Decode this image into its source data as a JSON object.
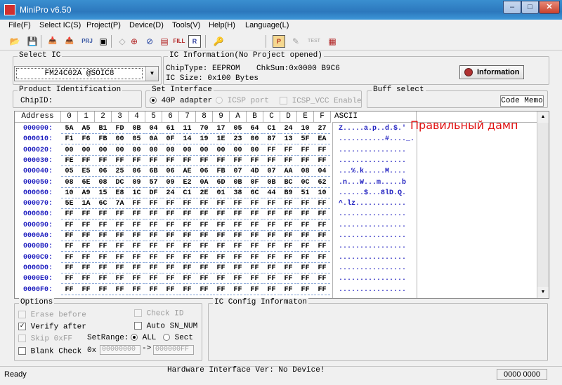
{
  "window": {
    "title": "MiniPro v6.50"
  },
  "menu": [
    "File(F)",
    "Select IC(S)",
    "Project(P)",
    "Device(D)",
    "Tools(V)",
    "Help(H)",
    "Language(L)"
  ],
  "toolbar": {
    "prj_label": "PRJ",
    "fill_label": "FILL",
    "r_label": "R",
    "p_label": "P",
    "test_label": "TEST"
  },
  "select_ic": {
    "label": "Select IC",
    "value": "FM24C02A @SOIC8"
  },
  "ic_info": {
    "label": "IC Information(No Project opened)",
    "chip_type": "ChipType: EEPROM",
    "checksum": "ChkSum:0x0000 B9C6",
    "ic_size": "IC Size:   0x100 Bytes",
    "info_button": "Information"
  },
  "product": {
    "label": "Product Identification",
    "chip_id": "ChipID:"
  },
  "interface": {
    "label": "Set Interface",
    "opt1": "40P adapter",
    "opt2": "ICSP port",
    "opt3": "ICSP_VCC Enable"
  },
  "buff": {
    "label": "Buff select",
    "value": "Code Memo"
  },
  "grid": {
    "address_header": "Address",
    "col_headers": [
      "0",
      "1",
      "2",
      "3",
      "4",
      "5",
      "6",
      "7",
      "8",
      "9",
      "A",
      "B",
      "C",
      "D",
      "E",
      "F"
    ],
    "ascii_header": "ASCII",
    "rows": [
      {
        "addr": "000000:",
        "bytes": [
          "5A",
          "A5",
          "B1",
          "FD",
          "0B",
          "04",
          "61",
          "11",
          "70",
          "17",
          "05",
          "64",
          "C1",
          "24",
          "10",
          "27"
        ],
        "ascii": "Z.....a.p..d.$.'"
      },
      {
        "addr": "000010:",
        "bytes": [
          "F1",
          "F6",
          "FB",
          "00",
          "05",
          "0A",
          "0F",
          "14",
          "19",
          "1E",
          "23",
          "00",
          "87",
          "13",
          "5F",
          "EA"
        ],
        "ascii": "...........#...._."
      },
      {
        "addr": "000020:",
        "bytes": [
          "00",
          "00",
          "00",
          "00",
          "00",
          "00",
          "00",
          "00",
          "00",
          "00",
          "00",
          "00",
          "FF",
          "FF",
          "FF",
          "FF"
        ],
        "ascii": "................"
      },
      {
        "addr": "000030:",
        "bytes": [
          "FE",
          "FF",
          "FF",
          "FF",
          "FF",
          "FF",
          "FF",
          "FF",
          "FF",
          "FF",
          "FF",
          "FF",
          "FF",
          "FF",
          "FF",
          "FF"
        ],
        "ascii": "................"
      },
      {
        "addr": "000040:",
        "bytes": [
          "05",
          "E5",
          "06",
          "25",
          "06",
          "6B",
          "06",
          "AE",
          "06",
          "FB",
          "07",
          "4D",
          "07",
          "AA",
          "08",
          "04"
        ],
        "ascii": "...%.k.....M...."
      },
      {
        "addr": "000050:",
        "bytes": [
          "08",
          "6E",
          "08",
          "DC",
          "09",
          "57",
          "09",
          "E2",
          "0A",
          "6D",
          "0B",
          "0F",
          "0B",
          "BC",
          "0C",
          "62"
        ],
        "ascii": ".n...W...m.....b"
      },
      {
        "addr": "000060:",
        "bytes": [
          "10",
          "A9",
          "15",
          "E8",
          "1C",
          "DF",
          "24",
          "C1",
          "2E",
          "01",
          "38",
          "6C",
          "44",
          "B9",
          "51",
          "10"
        ],
        "ascii": "......$...8lD.Q."
      },
      {
        "addr": "000070:",
        "bytes": [
          "5E",
          "1A",
          "6C",
          "7A",
          "FF",
          "FF",
          "FF",
          "FF",
          "FF",
          "FF",
          "FF",
          "FF",
          "FF",
          "FF",
          "FF",
          "FF"
        ],
        "ascii": "^.lz............"
      },
      {
        "addr": "000080:",
        "bytes": [
          "FF",
          "FF",
          "FF",
          "FF",
          "FF",
          "FF",
          "FF",
          "FF",
          "FF",
          "FF",
          "FF",
          "FF",
          "FF",
          "FF",
          "FF",
          "FF"
        ],
        "ascii": "................"
      },
      {
        "addr": "000090:",
        "bytes": [
          "FF",
          "FF",
          "FF",
          "FF",
          "FF",
          "FF",
          "FF",
          "FF",
          "FF",
          "FF",
          "FF",
          "FF",
          "FF",
          "FF",
          "FF",
          "FF"
        ],
        "ascii": "................"
      },
      {
        "addr": "0000A0:",
        "bytes": [
          "FF",
          "FF",
          "FF",
          "FF",
          "FF",
          "FF",
          "FF",
          "FF",
          "FF",
          "FF",
          "FF",
          "FF",
          "FF",
          "FF",
          "FF",
          "FF"
        ],
        "ascii": "................"
      },
      {
        "addr": "0000B0:",
        "bytes": [
          "FF",
          "FF",
          "FF",
          "FF",
          "FF",
          "FF",
          "FF",
          "FF",
          "FF",
          "FF",
          "FF",
          "FF",
          "FF",
          "FF",
          "FF",
          "FF"
        ],
        "ascii": "................"
      },
      {
        "addr": "0000C0:",
        "bytes": [
          "FF",
          "FF",
          "FF",
          "FF",
          "FF",
          "FF",
          "FF",
          "FF",
          "FF",
          "FF",
          "FF",
          "FF",
          "FF",
          "FF",
          "FF",
          "FF"
        ],
        "ascii": "................"
      },
      {
        "addr": "0000D0:",
        "bytes": [
          "FF",
          "FF",
          "FF",
          "FF",
          "FF",
          "FF",
          "FF",
          "FF",
          "FF",
          "FF",
          "FF",
          "FF",
          "FF",
          "FF",
          "FF",
          "FF"
        ],
        "ascii": "................"
      },
      {
        "addr": "0000E0:",
        "bytes": [
          "FF",
          "FF",
          "FF",
          "FF",
          "FF",
          "FF",
          "FF",
          "FF",
          "FF",
          "FF",
          "FF",
          "FF",
          "FF",
          "FF",
          "FF",
          "FF"
        ],
        "ascii": "................"
      },
      {
        "addr": "0000F0:",
        "bytes": [
          "FF",
          "FF",
          "FF",
          "FF",
          "FF",
          "FF",
          "FF",
          "FF",
          "FF",
          "FF",
          "FF",
          "FF",
          "FF",
          "FF",
          "FF",
          "FF"
        ],
        "ascii": "................"
      }
    ]
  },
  "annotation": "Правильный дамп",
  "options": {
    "label": "Options",
    "erase_before": "Erase before",
    "verify_after": "Verify after",
    "skip_0xff": "Skip 0xFF",
    "blank_check": "Blank Check",
    "check_id": "Check ID",
    "auto_sn": "Auto SN_NUM",
    "set_range": "SetRange:",
    "all": "ALL",
    "sect": "Sect",
    "prefix": "0x",
    "range_start": "00000000",
    "range_sep": "->",
    "range_end": "000000FF"
  },
  "ic_config": {
    "label": "IC Config Informaton"
  },
  "status": {
    "ready": "Ready",
    "hardware": "Hardware Interface Ver: No Device!",
    "counter": "0000 0000"
  }
}
